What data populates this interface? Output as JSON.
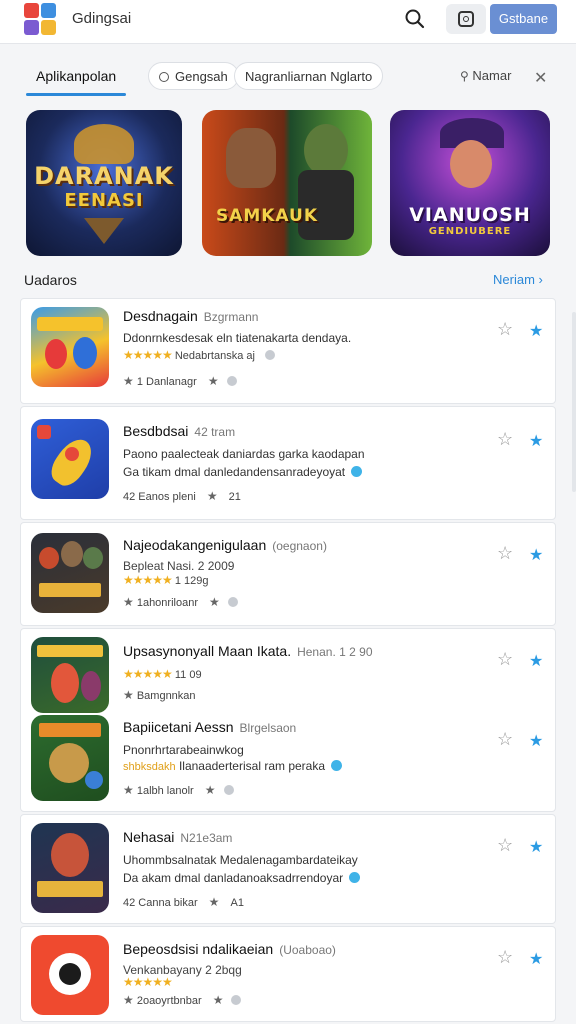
{
  "header": {
    "title": "Gdingsai",
    "primary_button": "Gstbane",
    "logo_colors": [
      "#e8463c",
      "#3e8fe0",
      "#f2b733",
      "#7b5bd1"
    ]
  },
  "tabs": {
    "active": "Aplikanpolan",
    "items": [
      "Gengsah",
      "Nagranliarnan Nglarto"
    ],
    "right_label": "Namar"
  },
  "featured": [
    {
      "word1": "DARANAK",
      "word2": "EENASI",
      "bg": "#1b2a5c"
    },
    {
      "word1": "SAMKAUK",
      "word2": "",
      "bg": "#3a2a1a"
    },
    {
      "word1": "VIANUOSH",
      "word2": "GENDIUBERE",
      "bg": "#3a1f66"
    }
  ],
  "section": {
    "title": "Uadaros",
    "link": "Neriam"
  },
  "apps": [
    {
      "title": "Desdnagain",
      "sub": "Bzgrmann",
      "desc": "Ddonrnkesdesak eln tiatenakarta dendaya.",
      "meta_line": "Nedabrtanska aj",
      "stars": "★★★★★",
      "footer": "1 Danlanagr",
      "colors": [
        "#f5c22c",
        "#e63a3a",
        "#2f6fd8"
      ]
    },
    {
      "title": "Besdbdsai",
      "sub": "42 tram",
      "desc": "Paono paalecteak daniardas garka kaodapan",
      "meta_line": "Ga tikam dmal danledandensanradeyoyat",
      "footer": "42 Eanos pleni",
      "footer2": "21",
      "colors": [
        "#2f5fd8",
        "#f2c12e",
        "#e5483a"
      ]
    },
    {
      "title": "Najeodakangenigulaan",
      "sub": "(oegnaon)",
      "desc": "Bepleat Nasi. 2 2009",
      "meta_line": "1 129g",
      "stars": "★★★★★",
      "footer": "1ahonriloanr",
      "colors": [
        "#2a2f3a",
        "#c74b2d",
        "#e8b23a"
      ]
    },
    {
      "title": "Upsasynonyall Maan Ikata.",
      "sub": "Henan. 1 2 90",
      "meta_line": "11 09",
      "stars": "★★★★★",
      "footer": "Bamgnnkan",
      "colors": [
        "#1f4e3d",
        "#e2573b",
        "#f0c13c"
      ]
    },
    {
      "title": "Bapiicetani Aessn",
      "sub": "Blrgelsaon",
      "desc": "Pnonrhrtarabeainwkog",
      "meta_line": "Ilanaaderterisal ram peraka",
      "stars_label": "shbksdakh",
      "footer": "1albh lanolr",
      "colors": [
        "#2d6c2f",
        "#e88b2a",
        "#3a7fd6"
      ]
    },
    {
      "title": "Nehasai",
      "sub": "N21e3am",
      "desc": "Uhommbsalnatak Medalenagambardateikay",
      "meta_line": "Da akam dmal danladanoaksadrrendoyar",
      "footer": "42 Canna bikar",
      "footer2": "A1",
      "colors": [
        "#1f3552",
        "#c7543a",
        "#e6b43c"
      ]
    },
    {
      "title": "Bepeosdsisi ndalikaeian",
      "sub": "(Uoaboao)",
      "desc": "Venkanbayany 2 2bqg",
      "stars": "★★★★★",
      "footer": "2oaoyrtbnbar",
      "colors": [
        "#ef4a2f",
        "#ffffff",
        "#1b1b1b"
      ]
    }
  ]
}
